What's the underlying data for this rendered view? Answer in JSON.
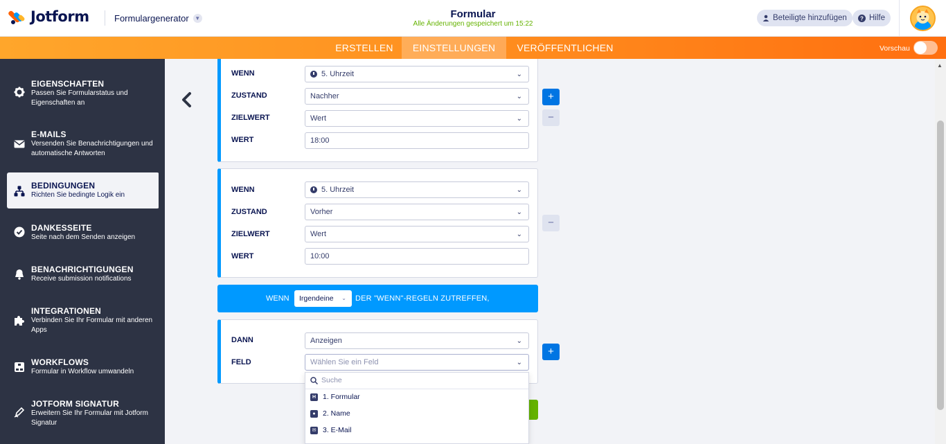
{
  "header": {
    "brand": "Jotform",
    "product": "Formulargenerator",
    "form_title": "Formular",
    "save_status": "Alle Änderungen gespeichert um 15:22",
    "invite_label": "Beteiligte hinzufügen",
    "help_label": "Hilfe"
  },
  "nav": {
    "tabs": [
      {
        "label": "ERSTELLEN"
      },
      {
        "label": "EINSTELLUNGEN"
      },
      {
        "label": "VERÖFFENTLICHEN"
      }
    ],
    "active_tab": "EINSTELLUNGEN",
    "preview_label": "Vorschau",
    "preview_on": false
  },
  "sidebar": {
    "items": [
      {
        "title": "EIGENSCHAFTEN",
        "desc": "Passen Sie Formularstatus und Eigenschaften an",
        "icon": "gear-icon"
      },
      {
        "title": "E-MAILS",
        "desc": "Versenden Sie Benachrichtigungen und automatische Antworten",
        "icon": "envelope-icon"
      },
      {
        "title": "BEDINGUNGEN",
        "desc": "Richten Sie bedingte Logik ein",
        "icon": "sitemap-icon"
      },
      {
        "title": "DANKESSEITE",
        "desc": "Seite nach dem Senden anzeigen",
        "icon": "check-circle-icon"
      },
      {
        "title": "BENACHRICHTIGUNGEN",
        "desc": "Receive submission notifications",
        "icon": "bell-icon"
      },
      {
        "title": "INTEGRATIONEN",
        "desc": "Verbinden Sie Ihr Formular mit anderen Apps",
        "icon": "puzzle-icon"
      },
      {
        "title": "WORKFLOWS",
        "desc": "Formular in Workflow umwandeln",
        "icon": "workflow-icon"
      },
      {
        "title": "JOTFORM SIGNATUR",
        "desc": "Erweitern Sie Ihr Formular mit Jotform Signatur",
        "icon": "pen-icon"
      }
    ],
    "active_item": "BEDINGUNGEN"
  },
  "conditions": [
    {
      "wenn_label": "WENN",
      "wenn_value": "5. Uhrzeit",
      "zustand_label": "ZUSTAND",
      "zustand_value": "Nachher",
      "zielwert_label": "ZIELWERT",
      "zielwert_value": "Wert",
      "wert_label": "WERT",
      "wert_value": "18:00"
    },
    {
      "wenn_label": "WENN",
      "wenn_value": "5. Uhrzeit",
      "zustand_label": "ZUSTAND",
      "zustand_value": "Vorher",
      "zielwert_label": "ZIELWERT",
      "zielwert_value": "Wert",
      "wert_label": "WERT",
      "wert_value": "10:00"
    }
  ],
  "rule_match": {
    "prefix": "WENN",
    "mode": "Irgendeine",
    "suffix": "DER \"WENN\"-REGELN ZUTREFFEN,"
  },
  "action": {
    "dann_label": "DANN",
    "dann_value": "Anzeigen",
    "feld_label": "FELD",
    "feld_placeholder": "Wählen Sie ein Feld"
  },
  "dropdown": {
    "search_placeholder": "Suche",
    "items": [
      {
        "label": "1. Formular",
        "icon": "heading-icon",
        "glyph": "H"
      },
      {
        "label": "2. Name",
        "icon": "user-card-icon",
        "glyph": "●"
      },
      {
        "label": "3. E-Mail",
        "icon": "envelope-icon",
        "glyph": "✉"
      },
      {
        "label": "",
        "icon": "phone-icon",
        "glyph": ""
      }
    ]
  },
  "colors": {
    "brand_navy": "#0a1551",
    "accent_blue": "#0099ff",
    "button_blue": "#0075e3",
    "orange": "#ff8f1f",
    "green": "#64b200",
    "sidebar_bg": "#2d3344"
  }
}
